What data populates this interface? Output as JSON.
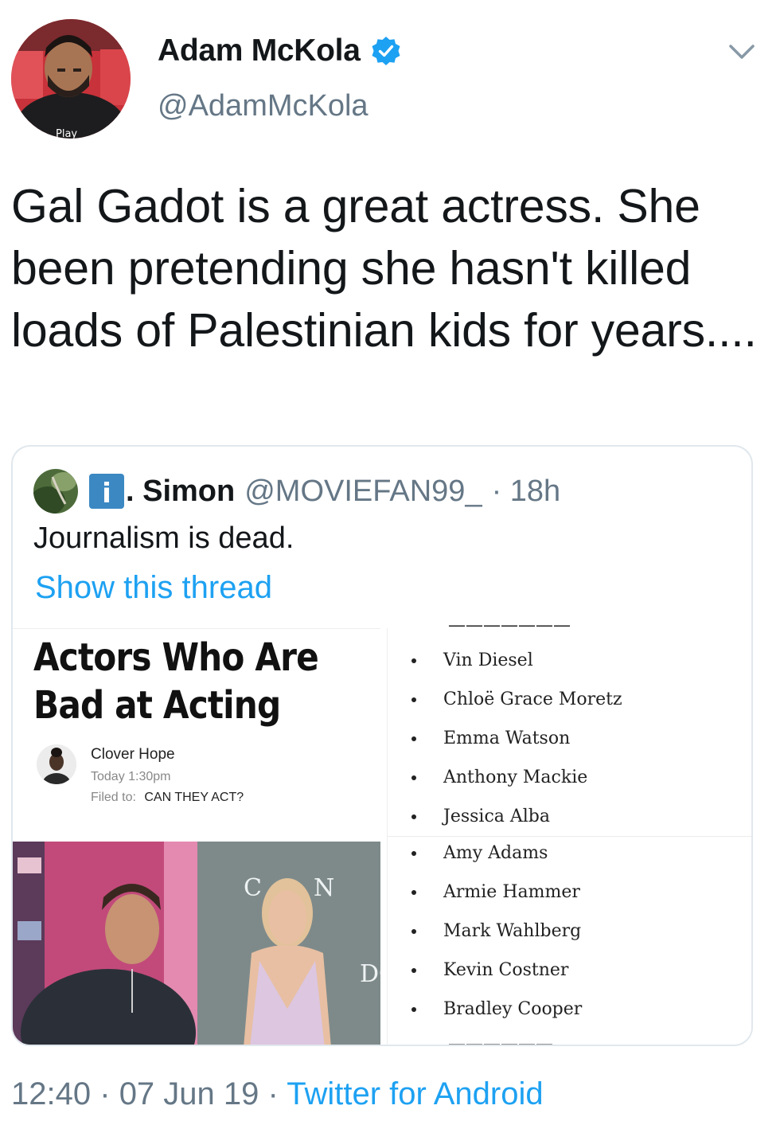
{
  "author": {
    "name": "Adam McKola",
    "handle": "@AdamMcKola",
    "verified": true
  },
  "tweet": {
    "text": "Gal Gadot is a great actress. She been pretending she hasn't killed loads of Palestinian kids for years....",
    "time": "12:40",
    "date": "07 Jun 19",
    "source": "Twitter for Android",
    "separator": "·"
  },
  "quoted": {
    "name_prefix": "i",
    "name": ". Simon",
    "handle": "@MOVIEFAN99_",
    "age": "· 18h",
    "text": "Journalism is dead.",
    "thread_link": "Show this thread",
    "article": {
      "title": "Actors Who Are Bad at Acting",
      "author": "Clover Hope",
      "date": "Today 1:30pm",
      "filed_label": "Filed to:",
      "filed_value": "CAN THEY ACT?"
    },
    "actors_top": [
      "Vin Diesel",
      "Chloë Grace Moretz",
      "Emma Watson",
      "Anthony Mackie",
      "Jessica Alba"
    ],
    "actors_bottom": [
      "Amy Adams",
      "Armie Hammer",
      "Mark Wahlberg",
      "Kevin Costner",
      "Bradley Cooper"
    ]
  },
  "colors": {
    "link": "#1da1f2",
    "secondary": "#657786",
    "border": "#e1e8ed",
    "verified": "#1da1f2"
  },
  "icons": [
    "verified-badge-icon",
    "chevron-down-icon",
    "info-icon"
  ]
}
